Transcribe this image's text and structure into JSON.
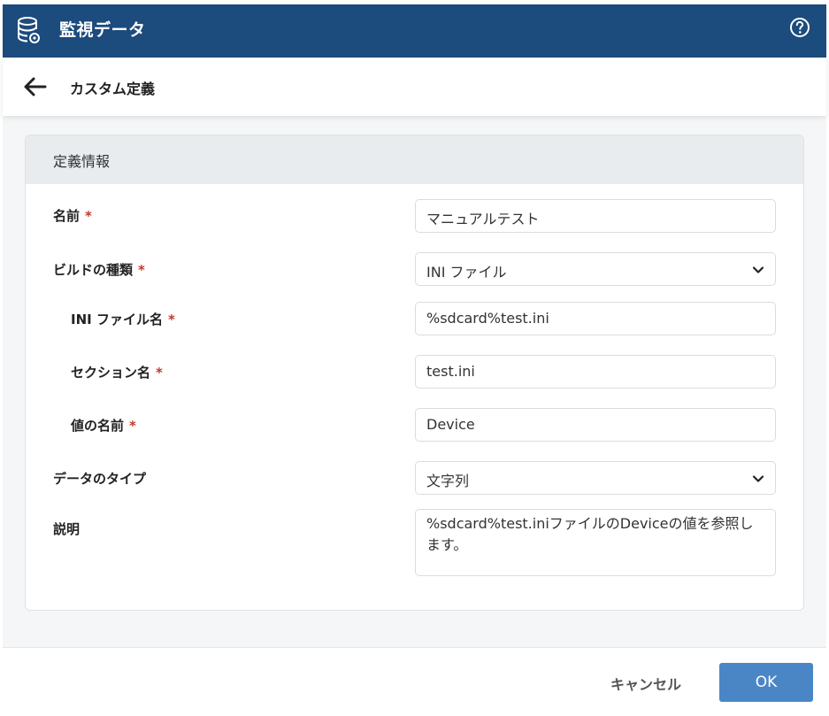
{
  "app": {
    "title": "監視データ",
    "db_icon": "database-gear-icon",
    "help_icon": "help-circle-icon"
  },
  "subheader": {
    "back_icon": "arrow-left-icon",
    "title": "カスタム定義"
  },
  "panel": {
    "title": "定義情報"
  },
  "form": {
    "required_mark": "*",
    "name": {
      "label": "名前",
      "value": "マニュアルテスト"
    },
    "build_type": {
      "label": "ビルドの種類",
      "value": "INI ファイル",
      "icon": "chevron-down-icon"
    },
    "ini_file": {
      "label": "INI ファイル名",
      "value": "%sdcard%test.ini"
    },
    "section": {
      "label": "セクション名",
      "value": "test.ini"
    },
    "value_name": {
      "label": "値の名前",
      "value": "Device"
    },
    "data_type": {
      "label": "データのタイプ",
      "value": "文字列",
      "icon": "chevron-down-icon"
    },
    "description": {
      "label": "説明",
      "value": "%sdcard%test.iniファイルのDeviceの値を参照します。"
    }
  },
  "footer": {
    "cancel_label": "キャンセル",
    "ok_label": "OK"
  },
  "colors": {
    "titlebar": "#1c4b7d",
    "accent_button": "#4a86c5",
    "required": "#c0392b"
  }
}
